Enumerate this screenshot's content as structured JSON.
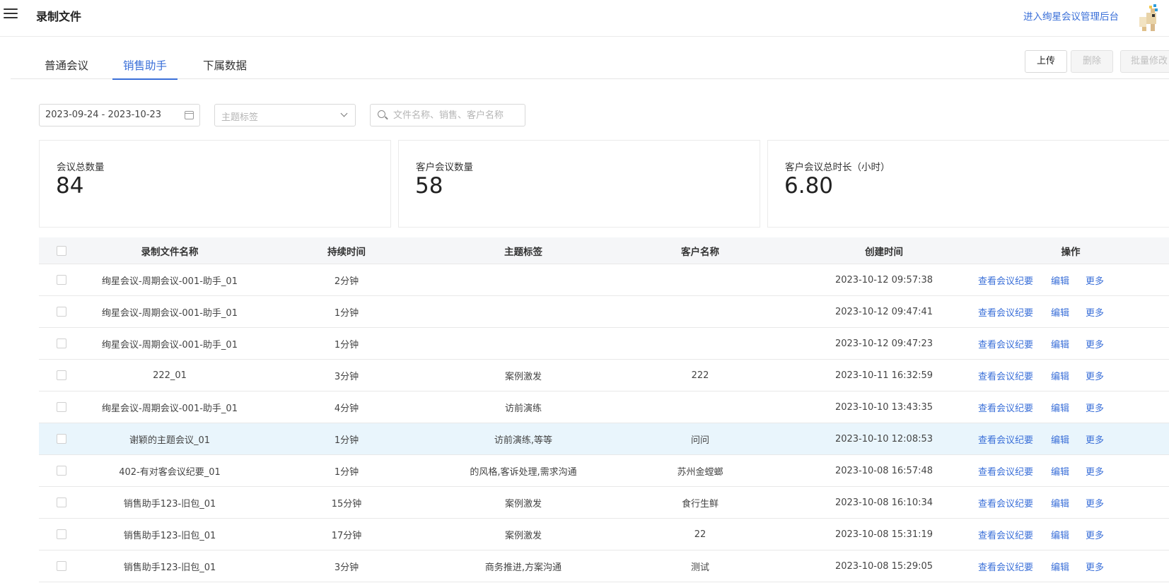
{
  "header": {
    "title": "录制文件",
    "admin_link": "进入绚星会议管理后台"
  },
  "tabs": [
    {
      "label": "普通会议",
      "active": false
    },
    {
      "label": "销售助手",
      "active": true
    },
    {
      "label": "下属数据",
      "active": false
    }
  ],
  "toolbar": {
    "upload_label": "上传",
    "delete_label": "删除",
    "batch_label": "批量修改"
  },
  "filters": {
    "date_range": "2023-09-24 - 2023-10-23",
    "tag_placeholder": "主题标签",
    "search_placeholder": "文件名称、销售、客户名称"
  },
  "stats": [
    {
      "label": "会议总数量",
      "value": "84"
    },
    {
      "label": "客户会议数量",
      "value": "58"
    },
    {
      "label": "客户会议总时长（小时）",
      "value": "6.80"
    }
  ],
  "table": {
    "columns": [
      "录制文件名称",
      "持续时间",
      "主题标签",
      "客户名称",
      "创建时间",
      "操作"
    ],
    "actions": {
      "view": "查看会议纪要",
      "edit": "编辑",
      "more": "更多"
    },
    "rows": [
      {
        "name": "绚星会议-周期会议-001-助手_01",
        "duration": "2分钟",
        "tag": "",
        "customer": "",
        "created": "2023-10-12 09:57:38"
      },
      {
        "name": "绚星会议-周期会议-001-助手_01",
        "duration": "1分钟",
        "tag": "",
        "customer": "",
        "created": "2023-10-12 09:47:41"
      },
      {
        "name": "绚星会议-周期会议-001-助手_01",
        "duration": "1分钟",
        "tag": "",
        "customer": "",
        "created": "2023-10-12 09:47:23"
      },
      {
        "name": "222_01",
        "duration": "3分钟",
        "tag": "案例激发",
        "customer": "222",
        "created": "2023-10-11 16:32:59"
      },
      {
        "name": "绚星会议-周期会议-001-助手_01",
        "duration": "4分钟",
        "tag": "访前演练",
        "customer": "",
        "created": "2023-10-10 13:43:35"
      },
      {
        "name": "谢颖的主题会议_01",
        "duration": "1分钟",
        "tag": "访前演练,等等",
        "customer": "问问",
        "created": "2023-10-10 12:08:53",
        "highlighted": true
      },
      {
        "name": "402-有对客会议纪要_01",
        "duration": "1分钟",
        "tag": "的风格,客诉处理,需求沟通",
        "customer": "苏州金螳螂",
        "created": "2023-10-08 16:57:48"
      },
      {
        "name": "销售助手123-旧包_01",
        "duration": "15分钟",
        "tag": "案例激发",
        "customer": "食行生鲜",
        "created": "2023-10-08 16:10:34"
      },
      {
        "name": "销售助手123-旧包_01",
        "duration": "17分钟",
        "tag": "案例激发",
        "customer": "22",
        "created": "2023-10-08 15:31:19"
      },
      {
        "name": "销售助手123-旧包_01",
        "duration": "3分钟",
        "tag": "商务推进,方案沟通",
        "customer": "测试",
        "created": "2023-10-08 15:29:05"
      }
    ]
  },
  "colors": {
    "accent": "#3a6fd8",
    "row_highlight": "#e9f5fc",
    "header_bg": "#f5f6f8"
  },
  "icons": [
    "menu-icon",
    "calendar-icon",
    "chevron-down-icon",
    "search-icon",
    "avatar"
  ]
}
